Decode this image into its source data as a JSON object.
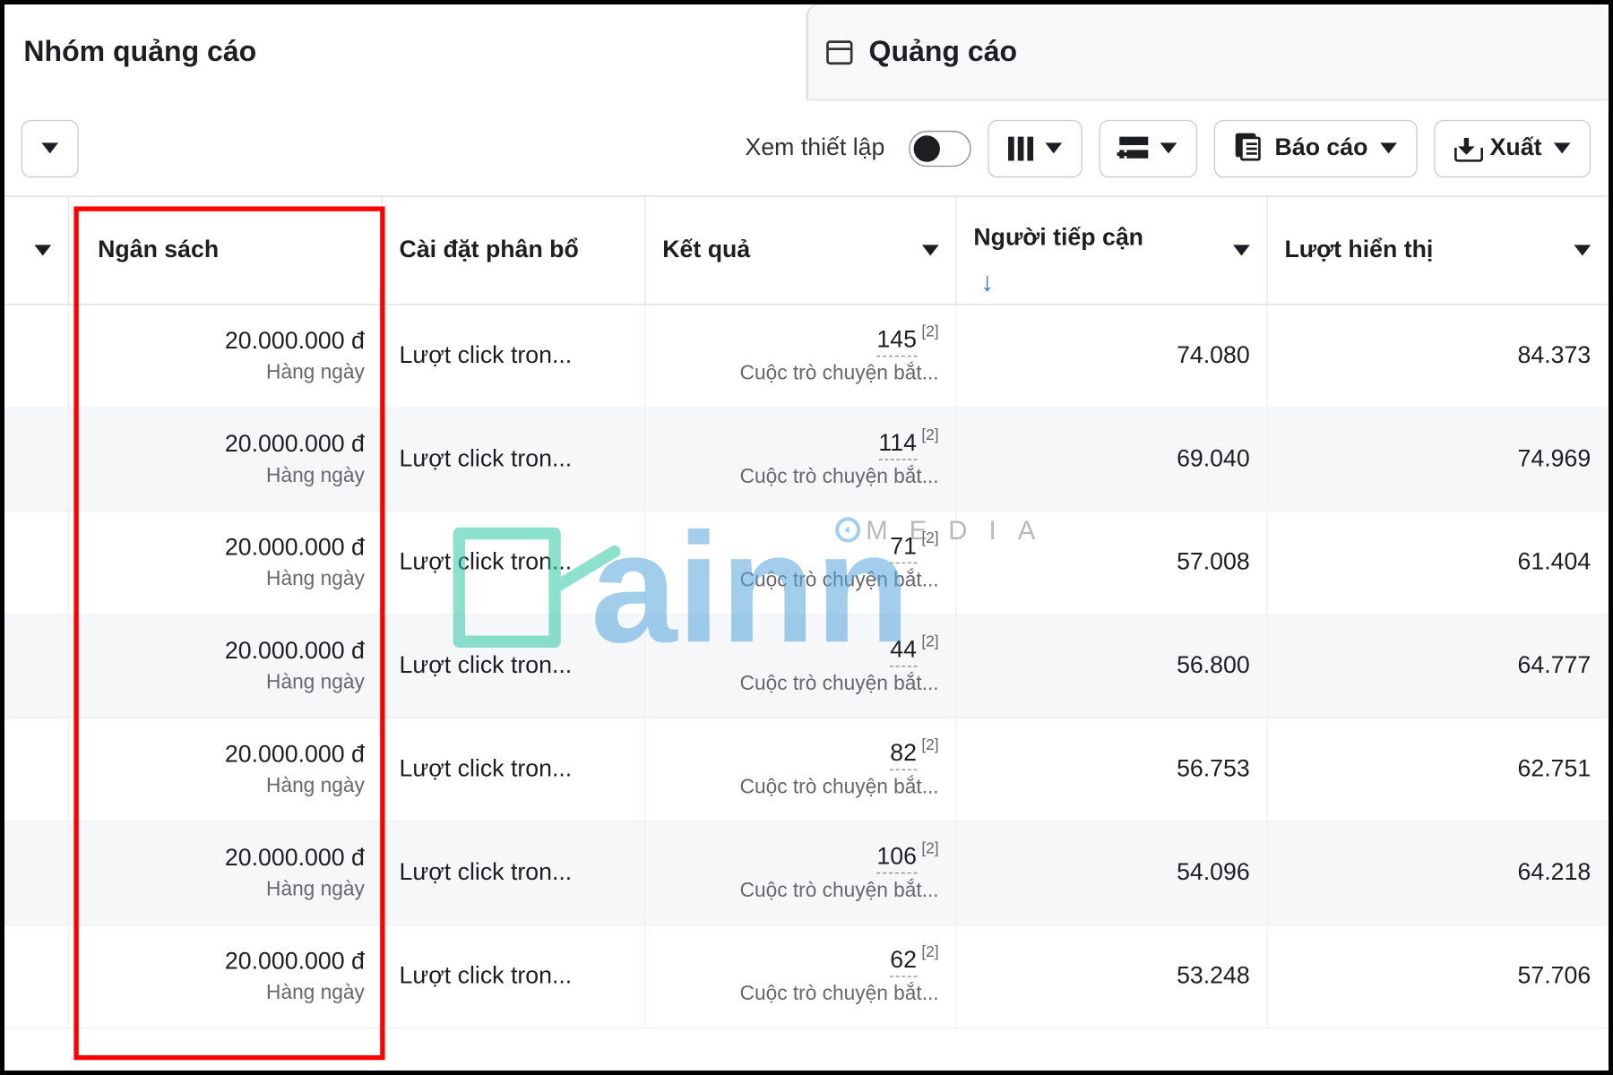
{
  "tabs": {
    "adset": "Nhóm quảng cáo",
    "ad": "Quảng cáo"
  },
  "toolbar": {
    "setup_label": "Xem thiết lập",
    "report": "Báo cáo",
    "export": "Xuất"
  },
  "columns": {
    "budget": "Ngân sách",
    "attribution": "Cài đặt phân bổ",
    "results": "Kết quả",
    "reach": "Người tiếp cận",
    "impressions": "Lượt hiển thị"
  },
  "row_labels": {
    "attr_text": "Lượt click tron...",
    "result_sub": "Cuộc trò chuyện bắt...",
    "budget_sub": "Hàng ngày",
    "sup": "[2]"
  },
  "rows": [
    {
      "budget": "20.000.000 đ",
      "result": "145",
      "reach": "74.080",
      "impr": "84.373"
    },
    {
      "budget": "20.000.000 đ",
      "result": "114",
      "reach": "69.040",
      "impr": "74.969"
    },
    {
      "budget": "20.000.000 đ",
      "result": "71",
      "reach": "57.008",
      "impr": "61.404"
    },
    {
      "budget": "20.000.000 đ",
      "result": "44",
      "reach": "56.800",
      "impr": "64.777"
    },
    {
      "budget": "20.000.000 đ",
      "result": "82",
      "reach": "56.753",
      "impr": "62.751"
    },
    {
      "budget": "20.000.000 đ",
      "result": "106",
      "reach": "54.096",
      "impr": "64.218"
    },
    {
      "budget": "20.000.000 đ",
      "result": "62",
      "reach": "53.248",
      "impr": "57.706"
    }
  ],
  "watermark": {
    "text": "ainn",
    "sub": "M E D I A"
  }
}
